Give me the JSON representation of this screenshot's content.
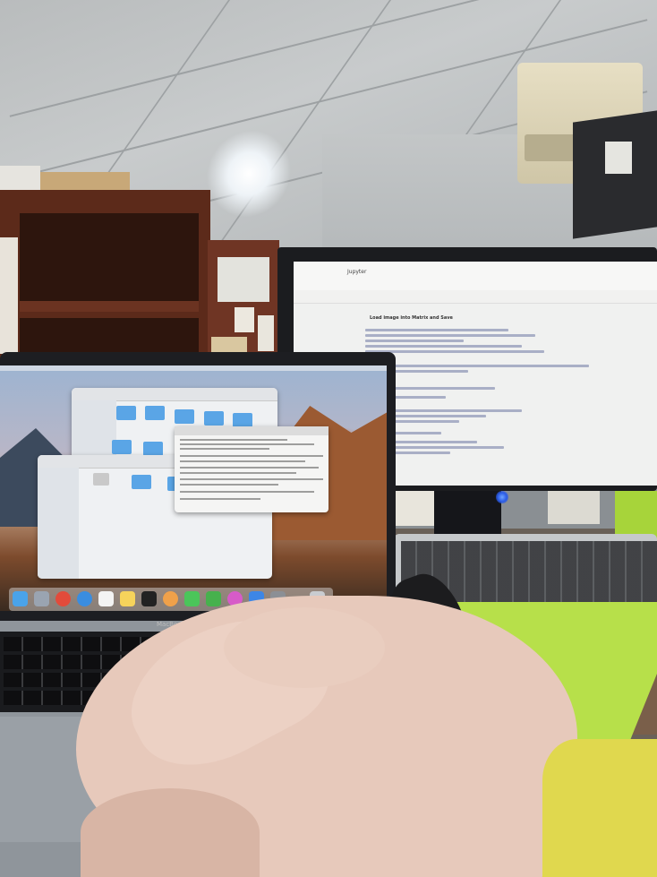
{
  "scene": {
    "description_labels": {
      "monitor_title": "Jupyter",
      "notebook_heading": "Load image into Matrix and Save",
      "laptop_brand": "MacBook Pro"
    }
  },
  "colors": {
    "wall": "#b9bcbd",
    "shelf": "#5c2a1a",
    "monitor_screen": "#f0f1f0",
    "laptop_wallpaper_orange": "#c75a22",
    "skin": "#e7c9bb",
    "green_sleeve": "#b7e04a",
    "yellow_sleeve": "#e0d84e",
    "monitor_led": "#2a5be6"
  },
  "icons": {
    "dock": [
      "finder-icon",
      "launchpad-icon",
      "chrome-icon",
      "safari-icon",
      "calendar-icon",
      "notes-icon",
      "terminal-icon",
      "photos-icon",
      "messages-icon",
      "facetime-icon",
      "itunes-icon",
      "appstore-icon",
      "preferences-icon",
      "trash-icon"
    ]
  }
}
